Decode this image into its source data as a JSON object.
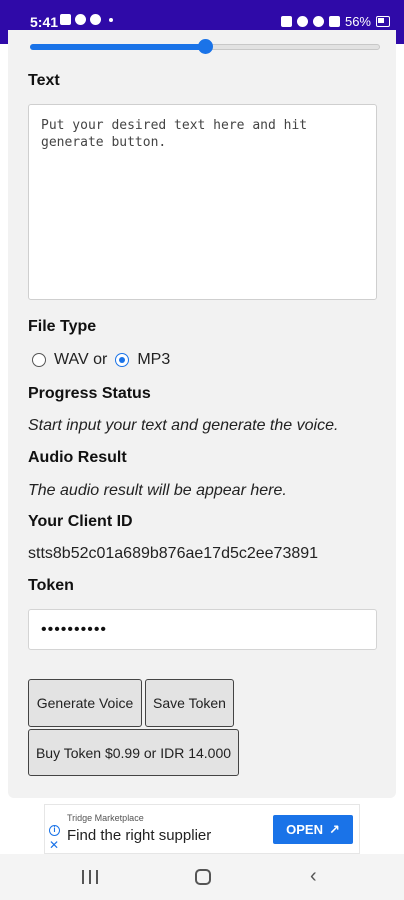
{
  "status_bar": {
    "time": "5:41",
    "battery": "56%",
    "icons": [
      "image-icon",
      "globe-icon",
      "whatsapp-icon",
      "dot-icon",
      "battery-saver-icon",
      "mute-icon",
      "wifi-icon",
      "signal-icon",
      "battery-icon"
    ]
  },
  "form": {
    "slider_value": 0.5,
    "text_label": "Text",
    "text_placeholder": "Put your desired text here and hit generate button.",
    "file_type_label": "File Type",
    "file_type_options": [
      "WAV or",
      "MP3"
    ],
    "file_type_selected": "MP3",
    "progress_label": "Progress Status",
    "progress_text": "Start input your text and generate the voice.",
    "audio_label": "Audio Result",
    "audio_text": "The audio result will be appear here.",
    "client_id_label": "Your Client ID",
    "client_id_value": "stts8b52c01a689b876ae17d5c2ee73891",
    "token_label": "Token",
    "token_value": "••••••••••"
  },
  "buttons": {
    "generate": "Generate Voice",
    "save_token": "Save Token",
    "buy_token": "Buy Token $0.99 or IDR 14.000"
  },
  "ad": {
    "sponsor": "Tridge Marketplace",
    "headline": "Find the right supplier",
    "cta": "OPEN"
  },
  "colors": {
    "status_bar": "#2f0aa8",
    "accent": "#1a73e8",
    "card_bg": "#f2f2f2"
  }
}
